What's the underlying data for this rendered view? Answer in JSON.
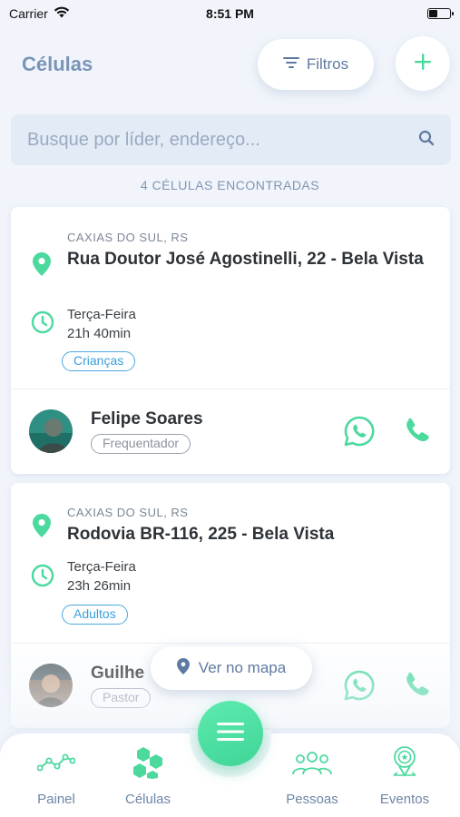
{
  "status_bar": {
    "carrier": "Carrier",
    "time": "8:51 PM"
  },
  "header": {
    "title": "Células",
    "filter_label": "Filtros"
  },
  "search": {
    "placeholder": "Busque por líder, endereço..."
  },
  "result_count": "4 CÉLULAS ENCONTRADAS",
  "cards": [
    {
      "city": "CAXIAS DO SUL, RS",
      "address": "Rua Doutor José Agostinelli, 22 - Bela Vista",
      "day": "Terça-Feira",
      "time": "21h 40min",
      "tag": "Crianças",
      "leader": "Felipe Soares",
      "role": "Frequentador"
    },
    {
      "city": "CAXIAS DO SUL, RS",
      "address": "Rodovia BR-116, 225 - Bela Vista",
      "day": "Terça-Feira",
      "time": "23h 26min",
      "tag": "Adultos",
      "leader": "Guilhe",
      "role": "Pastor"
    }
  ],
  "map_button_label": "Ver no mapa",
  "tabs": [
    {
      "label": "Painel",
      "icon": "chart-line-icon"
    },
    {
      "label": "Células",
      "icon": "hexagons-icon"
    },
    {
      "label": "Pessoas",
      "icon": "people-icon"
    },
    {
      "label": "Eventos",
      "icon": "location-badge-icon"
    }
  ],
  "colors": {
    "accent_green": "#4bd99e",
    "accent_blue": "#3a9fdb",
    "title_blue": "#7a94b8"
  }
}
